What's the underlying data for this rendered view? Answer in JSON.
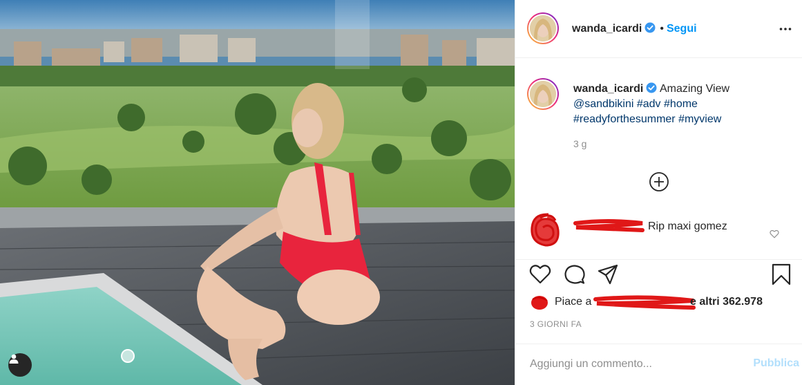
{
  "post": {
    "username": "wanda_icardi",
    "follow_label": "Segui",
    "dot": "•",
    "more_icon": "more-horizontal-icon",
    "verified_color": "#3897f0"
  },
  "caption": {
    "username": "wanda_icardi",
    "text": "Amazing View",
    "mention": "@sandbikini",
    "tags": [
      "#adv",
      "#home",
      "#readyforthesummer",
      "#myview"
    ],
    "time": "3 g"
  },
  "comments": [
    {
      "text": "Rip maxi gomez"
    }
  ],
  "likes": {
    "prefix": "Piace a",
    "suffix": "e altri 362.978"
  },
  "timestamp": "3 GIORNI FA",
  "comment_input": {
    "placeholder": "Aggiungi un commento...",
    "publish_label": "Pubblica"
  },
  "colors": {
    "link": "#00376b",
    "follow": "#0095f6",
    "publish_disabled": "#b2dffc",
    "muted": "#8e8e8e",
    "redaction": "#e01818"
  }
}
